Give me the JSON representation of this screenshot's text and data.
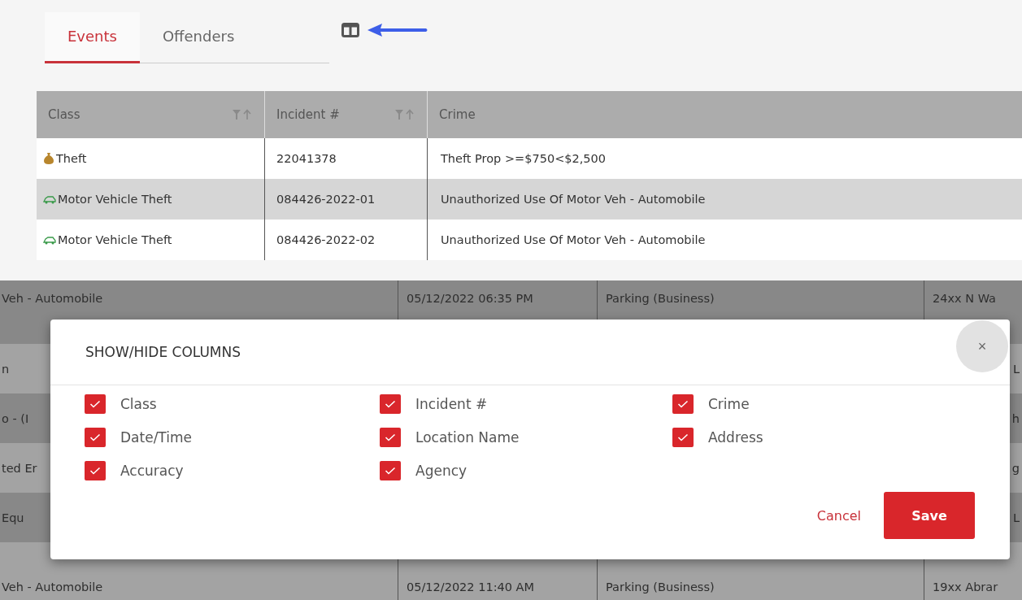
{
  "tabs": [
    {
      "label": "Events",
      "selected": true
    },
    {
      "label": "Offenders",
      "selected": false
    }
  ],
  "table": {
    "columns": [
      {
        "label": "Class",
        "sortable": true
      },
      {
        "label": "Incident #",
        "sortable": true
      },
      {
        "label": "Crime",
        "sortable": false
      }
    ],
    "rows": [
      {
        "class": "Theft",
        "kind": "property",
        "incident": "22041378",
        "crime": "Theft Prop >=$750<$2,500"
      },
      {
        "class": "Motor Vehicle Theft",
        "kind": "vehicle",
        "incident": "084426-2022-01",
        "crime": "Unauthorized Use Of Motor Veh - Automobile"
      },
      {
        "class": "Motor Vehicle Theft",
        "kind": "vehicle",
        "incident": "084426-2022-02",
        "crime": "Unauthorized Use Of Motor Veh - Automobile"
      }
    ]
  },
  "background_table": {
    "rows": [
      [
        "Veh - Automobile",
        "05/12/2022 06:35 PM",
        "Parking (Business)",
        "24xx N Wa"
      ],
      [
        "n",
        "",
        "",
        "L"
      ],
      [
        "o - (I",
        "",
        "",
        "h"
      ],
      [
        "ted Er",
        "",
        "",
        "g"
      ],
      [
        "Equ",
        "",
        "",
        "L"
      ],
      [
        "Veh - Automobile",
        "05/12/2022 11:40 AM",
        "Parking (Business)",
        "19xx Abrar"
      ]
    ]
  },
  "dialog": {
    "title": "SHOW/HIDE COLUMNS",
    "close": "×",
    "options": [
      {
        "label": "Class",
        "checked": true
      },
      {
        "label": "Incident #",
        "checked": true
      },
      {
        "label": "Crime",
        "checked": true
      },
      {
        "label": "Date/Time",
        "checked": true
      },
      {
        "label": "Location Name",
        "checked": true
      },
      {
        "label": "Address",
        "checked": true
      },
      {
        "label": "Accuracy",
        "checked": true
      },
      {
        "label": "Agency",
        "checked": true
      }
    ],
    "buttons": [
      {
        "label": "Cancel",
        "kind": "secondary"
      },
      {
        "label": "Save",
        "kind": "primary"
      }
    ]
  }
}
